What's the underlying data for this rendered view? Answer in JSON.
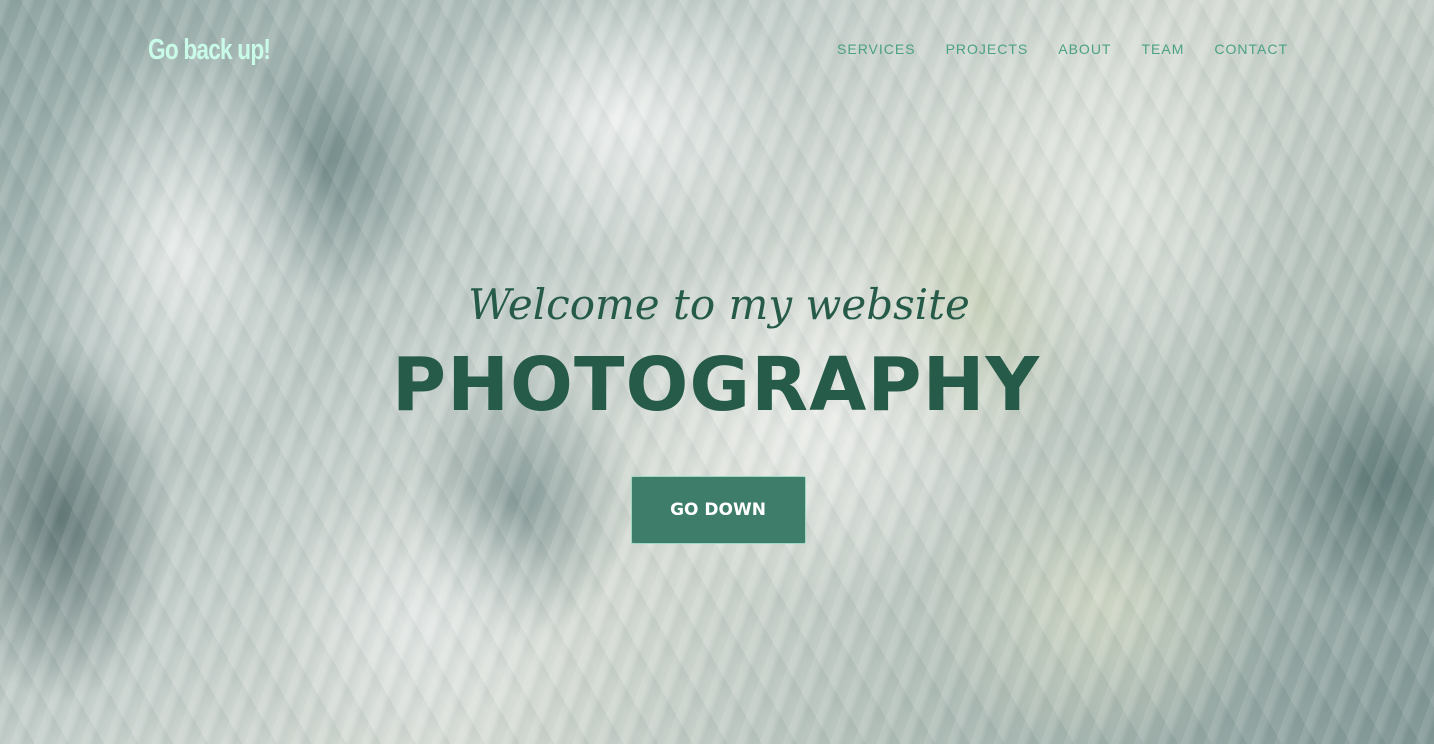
{
  "brand": {
    "label": "Go back up!",
    "color": "#c9fbe9"
  },
  "nav": {
    "items": [
      {
        "label": "SERVICES"
      },
      {
        "label": "PROJECTS"
      },
      {
        "label": "ABOUT"
      },
      {
        "label": "TEAM"
      },
      {
        "label": "CONTACT"
      }
    ],
    "color": "#4aa184"
  },
  "hero": {
    "tagline": "Welcome to my website",
    "heading": "PHOTOGRAPHY",
    "button_label": "GO DOWN",
    "text_color": "#265b4a",
    "button_color": "#3d7d69"
  }
}
